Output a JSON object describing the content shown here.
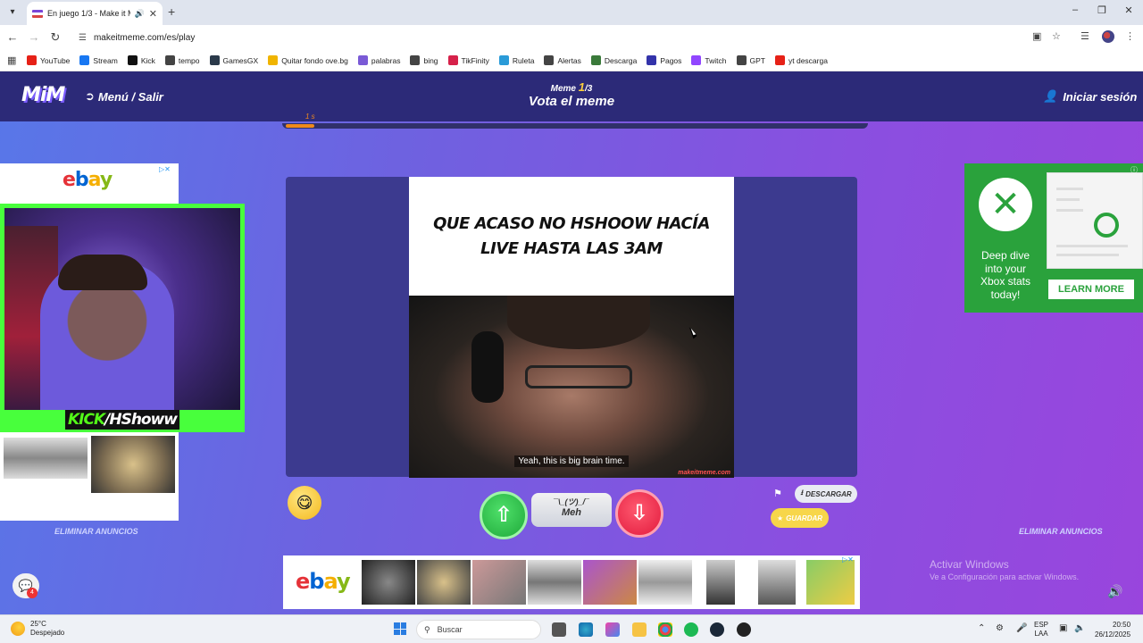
{
  "browser": {
    "tab": {
      "title": "En juego 1/3 - Make it Meme"
    },
    "url": "makeitmeme.com/es/play",
    "bookmarks": [
      {
        "label": "YouTube",
        "icon": "youtube-icon",
        "color": "#e62117"
      },
      {
        "label": "Stream",
        "icon": "meta-icon",
        "color": "#1877f2"
      },
      {
        "label": "Kick",
        "icon": "kick-icon",
        "color": "#111111"
      },
      {
        "label": "tempo",
        "icon": "tempo-icon",
        "color": "#444444"
      },
      {
        "label": "GamesGX",
        "icon": "gamesgx-icon",
        "color": "#2b3a4a"
      },
      {
        "label": "Quitar fondo ove.bg",
        "icon": "removebg-icon",
        "color": "#f0b400"
      },
      {
        "label": "palabras",
        "icon": "palabras-icon",
        "color": "#7a5ad6"
      },
      {
        "label": "bing",
        "icon": "search-icon",
        "color": "#444444"
      },
      {
        "label": "TikFinity",
        "icon": "tikfinity-icon",
        "color": "#d6214a"
      },
      {
        "label": "Ruleta",
        "icon": "ruleta-icon",
        "color": "#2a9bd8"
      },
      {
        "label": "Alertas",
        "icon": "alertas-icon",
        "color": "#444444"
      },
      {
        "label": "Descarga",
        "icon": "descarga-icon",
        "color": "#3a7a3a"
      },
      {
        "label": "Pagos",
        "icon": "pagos-icon",
        "color": "#3333aa"
      },
      {
        "label": "Twitch",
        "icon": "twitch-icon",
        "color": "#9146ff"
      },
      {
        "label": "GPT",
        "icon": "gpt-icon",
        "color": "#444444"
      },
      {
        "label": "yt descarga",
        "icon": "ytdescarga-icon",
        "color": "#e62117"
      }
    ]
  },
  "site": {
    "logo": "MiM",
    "menu_label": "Menú / Salir",
    "meme_word": "Meme",
    "meme_current": "1",
    "meme_total": "/3",
    "vote_title": "Vota el meme",
    "login_label": "Iniciar sesión",
    "timer_label": "1 s",
    "timer_progress": 0.05
  },
  "ads": {
    "remove_ads_left": "ELIMINAR ANUNCIOS",
    "remove_ads_right": "ELIMINAR ANUNCIOS",
    "xbox_text": "Deep dive into your Xbox stats today!",
    "xbox_button": "LEARN MORE",
    "ebay_letters": [
      "e",
      "b",
      "a",
      "y"
    ]
  },
  "stream": {
    "kick_label": "KICK",
    "channel_label": "/HShoww"
  },
  "meme": {
    "caption": "QUE ACASO NO HSHOOW HACÍA LIVE HASTA LAS 3AM",
    "subtitle": "Yeah, this is big brain time.",
    "watermark": "makeitmeme.com"
  },
  "vote": {
    "meh_face": "¯\\_(ツ)_/¯",
    "meh_label": "Meh",
    "download_label": "DESCARGAR",
    "save_label": "GUARDAR"
  },
  "chat": {
    "badge_count": "4"
  },
  "windows": {
    "activate_title": "Activar Windows",
    "activate_sub": "Ve a Configuración para activar Windows."
  },
  "taskbar": {
    "temperature": "25°C",
    "weather": "Despejado",
    "search_placeholder": "Buscar",
    "lang": "ESP",
    "lang_sub": "LAA",
    "time": "20:50",
    "date": "26/12/2025"
  }
}
